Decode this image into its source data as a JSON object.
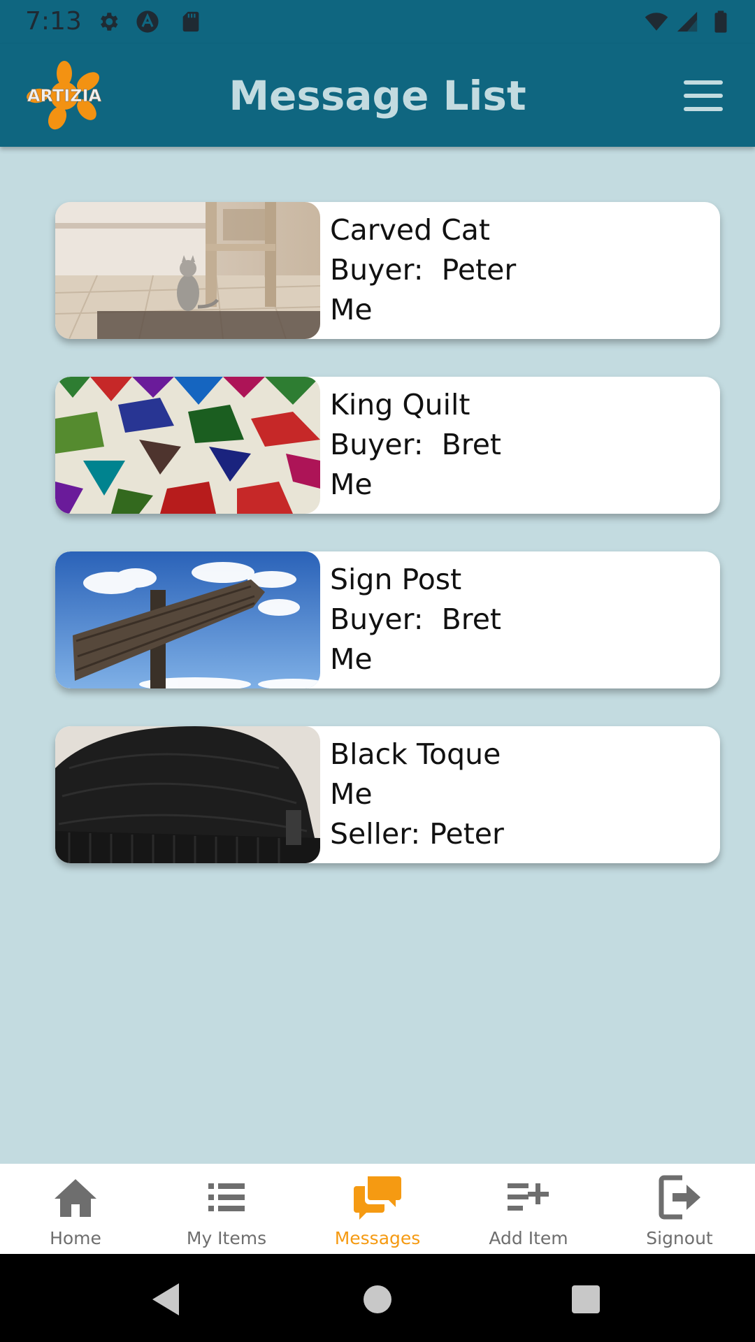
{
  "status_bar": {
    "time": "7:13"
  },
  "header": {
    "logo_text": "ARTIZIA",
    "title": "Message List"
  },
  "messages": [
    {
      "title": "Carved Cat",
      "line2": "Buyer:  Peter",
      "line3": "Me",
      "thumb": "carved-cat"
    },
    {
      "title": "King Quilt",
      "line2": "Buyer:  Bret",
      "line3": "Me",
      "thumb": "king-quilt"
    },
    {
      "title": "Sign Post",
      "line2": "Buyer:  Bret",
      "line3": "Me",
      "thumb": "sign-post"
    },
    {
      "title": "Black Toque",
      "line2": "Me",
      "line3": "Seller: Peter",
      "thumb": "black-toque"
    }
  ],
  "bottom_nav": {
    "items": [
      {
        "label": "Home",
        "icon": "home-icon"
      },
      {
        "label": "My Items",
        "icon": "list-icon"
      },
      {
        "label": "Messages",
        "icon": "chat-icon",
        "active": true
      },
      {
        "label": "Add Item",
        "icon": "add-list-icon"
      },
      {
        "label": "Signout",
        "icon": "signout-icon"
      }
    ]
  },
  "colors": {
    "header_bg": "#0f6680",
    "page_bg": "#c3dbe0",
    "accent": "#f59a12",
    "nav_inactive": "#6e6e6e"
  }
}
